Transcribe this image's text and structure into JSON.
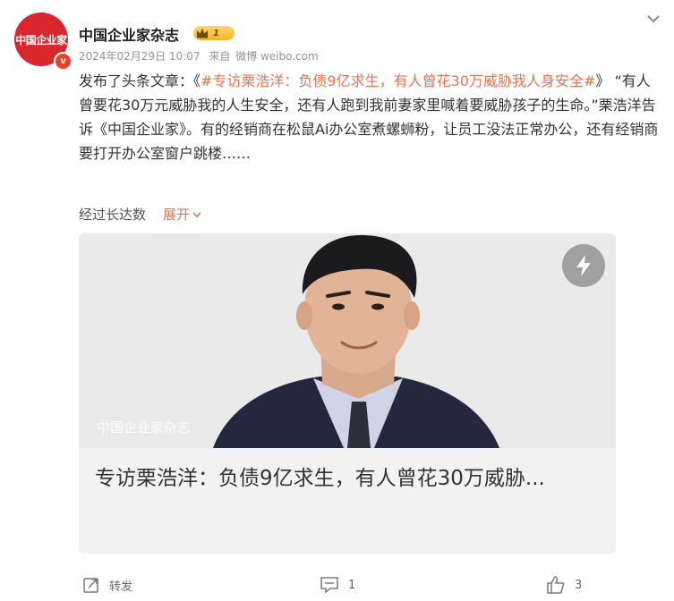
{
  "account": {
    "name": "中国企业家杂志",
    "avatar_text": "中国企业家",
    "verified_mark": "v",
    "level": "1"
  },
  "meta": {
    "date": "2024年02月29日 10:07",
    "source_prefix": "来自",
    "source": "微博 weibo.com"
  },
  "post": {
    "lead": "发布了头条文章：《",
    "topic": "#专访栗浩洋：负债9亿求生，有人曾花30万威胁我人身安全#",
    "after": "》 “有人曾要花30万元威胁我的人生安全，还有人跑到我前妻家里喊着要威胁孩子的生命。”栗浩洋告诉《中国企业家》。有的经销商在松鼠Ai办公室煮螺蛳粉，让员工没法正常办公，还有经销商要打开办公室窗户跳楼……"
  },
  "translation": {
    "label": "经过长达数",
    "expand": "展开"
  },
  "card": {
    "watermark": "中国企业家杂志",
    "title": "专访栗浩洋：负债9亿求生，有人曾花30万威胁..."
  },
  "footer": {
    "repost_label": "转发",
    "comment_count": "1",
    "like_count": "3"
  },
  "icons": [
    "chevron-down-icon",
    "crown-icon",
    "bolt-icon",
    "repost-icon",
    "comment-icon",
    "like-icon",
    "verified-icon"
  ],
  "colors": {
    "accent": "#eb7350",
    "brand_red": "#d9272e"
  }
}
